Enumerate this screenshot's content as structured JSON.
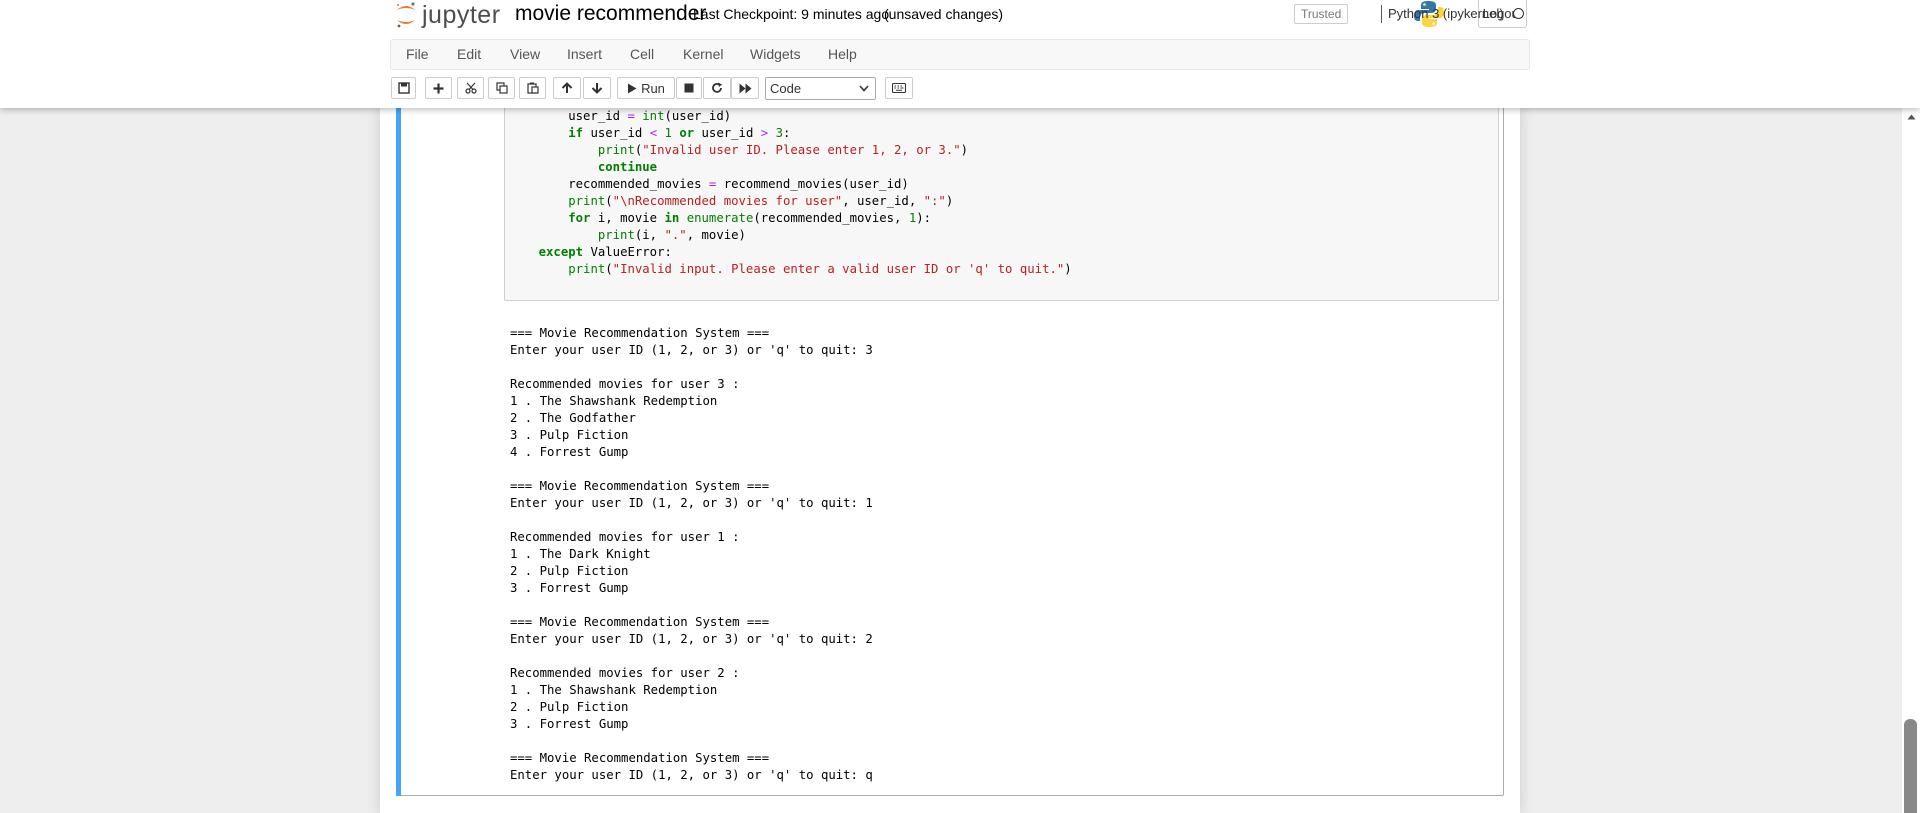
{
  "header": {
    "logo_text": "jupyter",
    "notebook_name": "movie recommender",
    "checkpoint": "Last Checkpoint: 9 minutes ago",
    "autosave_status": "(unsaved changes)",
    "logout_label": "Logout"
  },
  "menubar": {
    "items": [
      "File",
      "Edit",
      "View",
      "Insert",
      "Cell",
      "Kernel",
      "Widgets",
      "Help"
    ],
    "trusted_label": "Trusted",
    "kernel_name": "Python 3 (ipykernel)"
  },
  "toolbar": {
    "run_label": "Run",
    "cell_type": "Code",
    "icons": [
      "save-icon",
      "plus-icon",
      "cut-icon",
      "copy-icon",
      "paste-icon",
      "arrow-up-icon",
      "arrow-down-icon",
      "play-icon",
      "stop-icon",
      "restart-icon",
      "fast-forward-icon",
      "keyboard-icon"
    ]
  },
  "code_lines": [
    [
      [
        "plain",
        "        user_id "
      ],
      [
        "op",
        "="
      ],
      [
        "plain",
        " "
      ],
      [
        "bi",
        "int"
      ],
      [
        "plain",
        "(user_id)"
      ]
    ],
    [
      [
        "plain",
        "        "
      ],
      [
        "kw",
        "if"
      ],
      [
        "plain",
        " user_id "
      ],
      [
        "op",
        "<"
      ],
      [
        "plain",
        " "
      ],
      [
        "num",
        "1"
      ],
      [
        "plain",
        " "
      ],
      [
        "kw",
        "or"
      ],
      [
        "plain",
        " user_id "
      ],
      [
        "op",
        ">"
      ],
      [
        "plain",
        " "
      ],
      [
        "num",
        "3"
      ],
      [
        "plain",
        ":"
      ]
    ],
    [
      [
        "plain",
        "            "
      ],
      [
        "bi",
        "print"
      ],
      [
        "plain",
        "("
      ],
      [
        "str",
        "\"Invalid user ID. Please enter 1, 2, or 3.\""
      ],
      [
        "plain",
        ")"
      ]
    ],
    [
      [
        "plain",
        "            "
      ],
      [
        "kw",
        "continue"
      ]
    ],
    [
      [
        "plain",
        "        recommended_movies "
      ],
      [
        "op",
        "="
      ],
      [
        "plain",
        " recommend_movies(user_id)"
      ]
    ],
    [
      [
        "plain",
        "        "
      ],
      [
        "bi",
        "print"
      ],
      [
        "plain",
        "("
      ],
      [
        "str",
        "\"\\nRecommended movies for user\""
      ],
      [
        "plain",
        ", user_id, "
      ],
      [
        "str",
        "\":\""
      ],
      [
        "plain",
        ")"
      ]
    ],
    [
      [
        "plain",
        "        "
      ],
      [
        "kw",
        "for"
      ],
      [
        "plain",
        " i, movie "
      ],
      [
        "kw",
        "in"
      ],
      [
        "plain",
        " "
      ],
      [
        "bi",
        "enumerate"
      ],
      [
        "plain",
        "(recommended_movies, "
      ],
      [
        "num",
        "1"
      ],
      [
        "plain",
        "):"
      ]
    ],
    [
      [
        "plain",
        "            "
      ],
      [
        "bi",
        "print"
      ],
      [
        "plain",
        "(i, "
      ],
      [
        "str",
        "\".\""
      ],
      [
        "plain",
        ", movie)"
      ]
    ],
    [
      [
        "plain",
        "    "
      ],
      [
        "kw",
        "except"
      ],
      [
        "plain",
        " ValueError:"
      ]
    ],
    [
      [
        "plain",
        "        "
      ],
      [
        "bi",
        "print"
      ],
      [
        "plain",
        "("
      ],
      [
        "str",
        "\"Invalid input. Please enter a valid user ID or 'q' to quit.\""
      ],
      [
        "plain",
        ")"
      ]
    ]
  ],
  "output_lines": [
    "=== Movie Recommendation System ===",
    "Enter your user ID (1, 2, or 3) or 'q' to quit: 3",
    "",
    "Recommended movies for user 3 :",
    "1 . The Shawshank Redemption",
    "2 . The Godfather",
    "3 . Pulp Fiction",
    "4 . Forrest Gump",
    "",
    "=== Movie Recommendation System ===",
    "Enter your user ID (1, 2, or 3) or 'q' to quit: 1",
    "",
    "Recommended movies for user 1 :",
    "1 . The Dark Knight",
    "2 . Pulp Fiction",
    "3 . Forrest Gump",
    "",
    "=== Movie Recommendation System ===",
    "Enter your user ID (1, 2, or 3) or 'q' to quit: 2",
    "",
    "Recommended movies for user 2 :",
    "1 . The Shawshank Redemption",
    "2 . Pulp Fiction",
    "3 . Forrest Gump",
    "",
    "=== Movie Recommendation System ===",
    "Enter your user ID (1, 2, or 3) or 'q' to quit: q"
  ],
  "colors": {
    "cell_selected_bar": "#42a5f5",
    "keyword": "#008000",
    "string": "#ba2121",
    "operator": "#aa22ff",
    "jupyter_orange": "#f37726"
  }
}
